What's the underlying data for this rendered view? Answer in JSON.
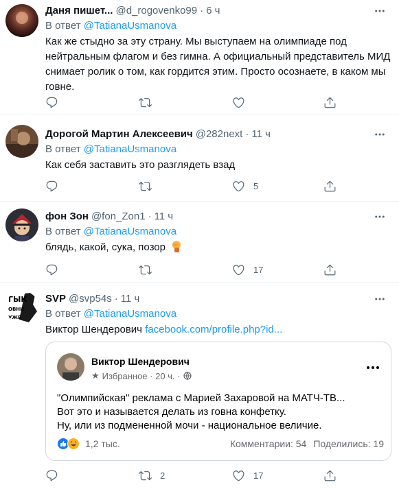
{
  "reply_prefix": "В ответ ",
  "tweets": [
    {
      "name": "Даня пишет...",
      "handle": "@d_rogovenko99",
      "dot": "·",
      "time": "6 ч",
      "reply_to": "@TatianaUsmanova",
      "text": "Как же стыдно за эту страну. Мы выступаем на олимпиаде под нейтральным флагом и без гимна. А официальный представитель МИД снимает ролик о том, как гордится этим. Просто осознаете, в каком мы говне.",
      "counts": {
        "reply": "",
        "retweet": "",
        "like": ""
      }
    },
    {
      "name": "Дорогой Мартин Алексеевич",
      "handle": "@282next",
      "dot": "·",
      "time": "11 ч",
      "reply_to": "@TatianaUsmanova",
      "text": "Как себя заставить это разглядеть взад",
      "counts": {
        "reply": "",
        "retweet": "",
        "like": "5"
      }
    },
    {
      "name": "фон Зон",
      "handle": "@fon_Zon1",
      "dot": "·",
      "time": "11 ч",
      "reply_to": "@TatianaUsmanova",
      "text": "блядь, какой, сука, позор",
      "emoji": "facepalm",
      "counts": {
        "reply": "",
        "retweet": "",
        "like": "17"
      }
    },
    {
      "name": "SVP",
      "handle": "@svp54s",
      "dot": "·",
      "time": "11 ч",
      "reply_to": "@TatianaUsmanova",
      "text": "Виктор Шендерович ",
      "link": "facebook.com/profile.php?id...",
      "counts": {
        "reply": "",
        "retweet": "2",
        "like": "17"
      },
      "avatar_text": [
        "ГЫК",
        "ОВНИ",
        "УЖЕ"
      ]
    }
  ],
  "card": {
    "name": "Виктор Шендерович",
    "meta_star": "★",
    "meta": "Избранное · 20 ч. ·",
    "lines": [
      "\"Олимпийская\" реклама с Марией Захаровой на МАТЧ-ТВ...",
      "Вот это и называется делать из говна конфетку.",
      "Ну, или из подмененной мочи - национальное величие."
    ],
    "reactions_count": "1,2 тыс.",
    "comments": "Комментарии: 54",
    "shares": "Поделились: 19"
  },
  "colors": {
    "link": "#1d9bf0",
    "muted": "#536471",
    "text": "#0f1419",
    "divider": "#eff3f4",
    "fb_blue": "#1877f2"
  },
  "icons": [
    "reply-icon",
    "retweet-icon",
    "like-icon",
    "share-icon",
    "more-icon",
    "globe-icon"
  ]
}
